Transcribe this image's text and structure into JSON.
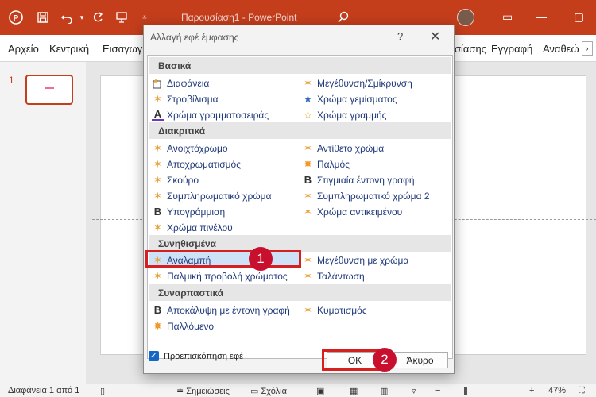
{
  "titlebar": {
    "title": "Παρουσίαση1  -  PowerPoint"
  },
  "tabs": [
    "Αρχείο",
    "Κεντρική",
    "Εισαγωγ",
    "σίασης",
    "Εγγραφή",
    "Αναθεώ"
  ],
  "slide_panel": {
    "number": "1"
  },
  "status": {
    "slide": "Διαφάνεια 1 από 1",
    "notes": "Σημειώσεις",
    "comments": "Σχόλια",
    "zoom": "47%"
  },
  "dialog": {
    "title": "Αλλαγή εφέ έμφασης",
    "help": "?",
    "categories": {
      "basic": "Βασικά",
      "subtle": "Διακριτικά",
      "moderate": "Συνηθισμένα",
      "exciting": "Συναρπαστικά"
    },
    "effects": {
      "transparency": "Διαφάνεια",
      "grow_shrink": "Μεγέθυνση/Σμίκρυνση",
      "spin": "Στροβίλισμα",
      "fill_color": "Χρώμα γεμίσματος",
      "font_color": "Χρώμα γραμματοσειράς",
      "line_color": "Χρώμα γραμμής",
      "lighten": "Ανοιχτόχρωμο",
      "complementary_contrast": "Αντίθετο χρώμα",
      "desaturate": "Αποχρωματισμός",
      "pulse": "Παλμός",
      "darken": "Σκούρο",
      "bold_flash": "Στιγμιαία έντονη γραφή",
      "complementary": "Συμπληρωματικό χρώμα",
      "complementary2": "Συμπληρωματικό χρώμα 2",
      "underline": "Υπογράμμιση",
      "object_color": "Χρώμα αντικειμένου",
      "brush_color": "Χρώμα πινέλου",
      "flicker": "Αναλαμπή",
      "grow_with_color": "Μεγέθυνση με χρώμα",
      "color_pulse": "Παλμική προβολή χρώματος",
      "teeter": "Ταλάντωση",
      "bold_reveal": "Αποκάλυψη με έντονη γραφή",
      "wave": "Κυματισμός",
      "blink": "Παλλόμενο"
    },
    "selected": "Αναλαμπή",
    "preview_label": "Προεπισκόπηση εφέ",
    "preview_checked": true,
    "ok_label": "OK",
    "cancel_label": "Άκυρο"
  },
  "annotations": {
    "badge1": "1",
    "badge2": "2"
  },
  "colors": {
    "titlebar": "#c43e1c",
    "annotation_red": "#d62020",
    "selection": "#cde2f7"
  }
}
